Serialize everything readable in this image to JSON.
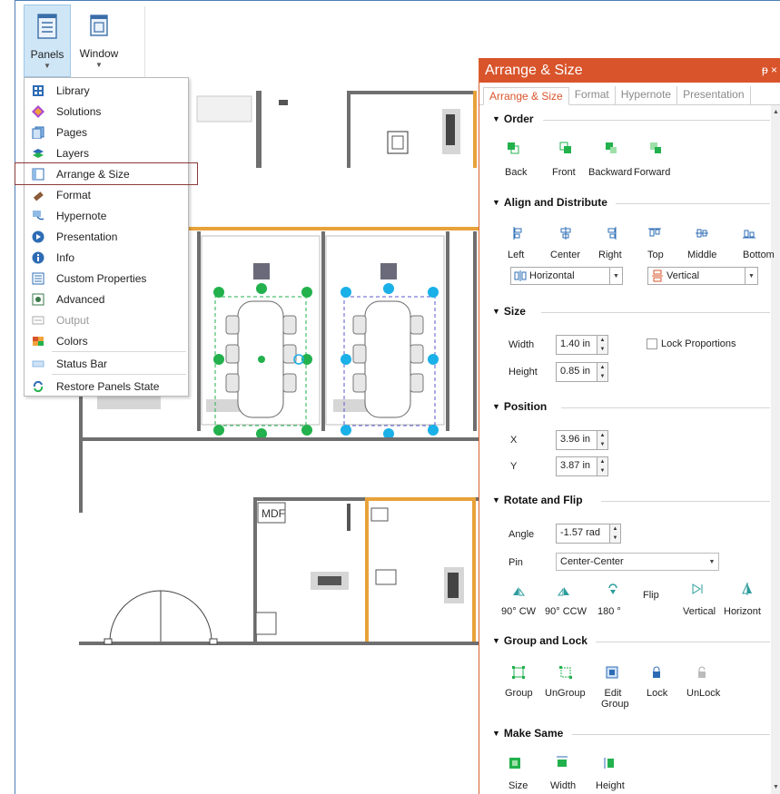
{
  "ribbon": {
    "panels_label": "Panels",
    "window_label": "Window"
  },
  "menu": {
    "items": [
      {
        "label": "Library",
        "icon": "library-icon"
      },
      {
        "label": "Solutions",
        "icon": "solutions-icon"
      },
      {
        "label": "Pages",
        "icon": "pages-icon"
      },
      {
        "label": "Layers",
        "icon": "layers-icon"
      },
      {
        "label": "Arrange & Size",
        "icon": "arrange-size-icon"
      },
      {
        "label": "Format",
        "icon": "format-icon"
      },
      {
        "label": "Hypernote",
        "icon": "hypernote-icon"
      },
      {
        "label": "Presentation",
        "icon": "presentation-icon"
      },
      {
        "label": "Info",
        "icon": "info-icon"
      },
      {
        "label": "Custom Properties",
        "icon": "custom-properties-icon"
      },
      {
        "label": "Advanced",
        "icon": "advanced-icon"
      },
      {
        "label": "Output",
        "icon": "output-icon"
      },
      {
        "label": "Colors",
        "icon": "colors-icon"
      },
      {
        "label": "Status Bar",
        "icon": "status-bar-icon"
      },
      {
        "label": "Restore Panels State",
        "icon": "restore-icon"
      }
    ]
  },
  "canvas": {
    "mdf_label": "MDF"
  },
  "panel": {
    "title": "Arrange & Size",
    "pin": "p ×",
    "tabs": [
      "Arrange & Size",
      "Format",
      "Hypernote",
      "Presentation"
    ],
    "order": {
      "title": "Order",
      "buttons": [
        "Back",
        "Front",
        "Backward",
        "Forward"
      ]
    },
    "align": {
      "title": "Align and Distribute",
      "buttons": [
        "Left",
        "Center",
        "Right",
        "Top",
        "Middle",
        "Bottom"
      ],
      "horizontal": "Horizontal",
      "vertical": "Vertical"
    },
    "size": {
      "title": "Size",
      "width_label": "Width",
      "width_value": "1.40 in",
      "height_label": "Height",
      "height_value": "0.85 in",
      "lock_label": "Lock Proportions"
    },
    "position": {
      "title": "Position",
      "x_label": "X",
      "x_value": "3.96 in",
      "y_label": "Y",
      "y_value": "3.87 in"
    },
    "rotate": {
      "title": "Rotate and Flip",
      "angle_label": "Angle",
      "angle_value": "-1.57 rad",
      "pin_label": "Pin",
      "pin_value": "Center-Center",
      "buttons": [
        "90° CW",
        "90° CCW",
        "180 °"
      ],
      "flip_label": "Flip",
      "flip_buttons": [
        "Vertical",
        "Horizont"
      ]
    },
    "group": {
      "title": "Group and Lock",
      "buttons": [
        "Group",
        "UnGroup",
        "Edit Group",
        "Lock",
        "UnLock"
      ]
    },
    "same": {
      "title": "Make Same",
      "buttons": [
        "Size",
        "Width",
        "Height"
      ]
    }
  },
  "colors": {
    "accent": "#d9542b",
    "selection_green": "#22b14c",
    "selection_blue": "#1ab0e8",
    "wall": "#6f6f6f",
    "wall_highlight": "#e8a23a"
  }
}
